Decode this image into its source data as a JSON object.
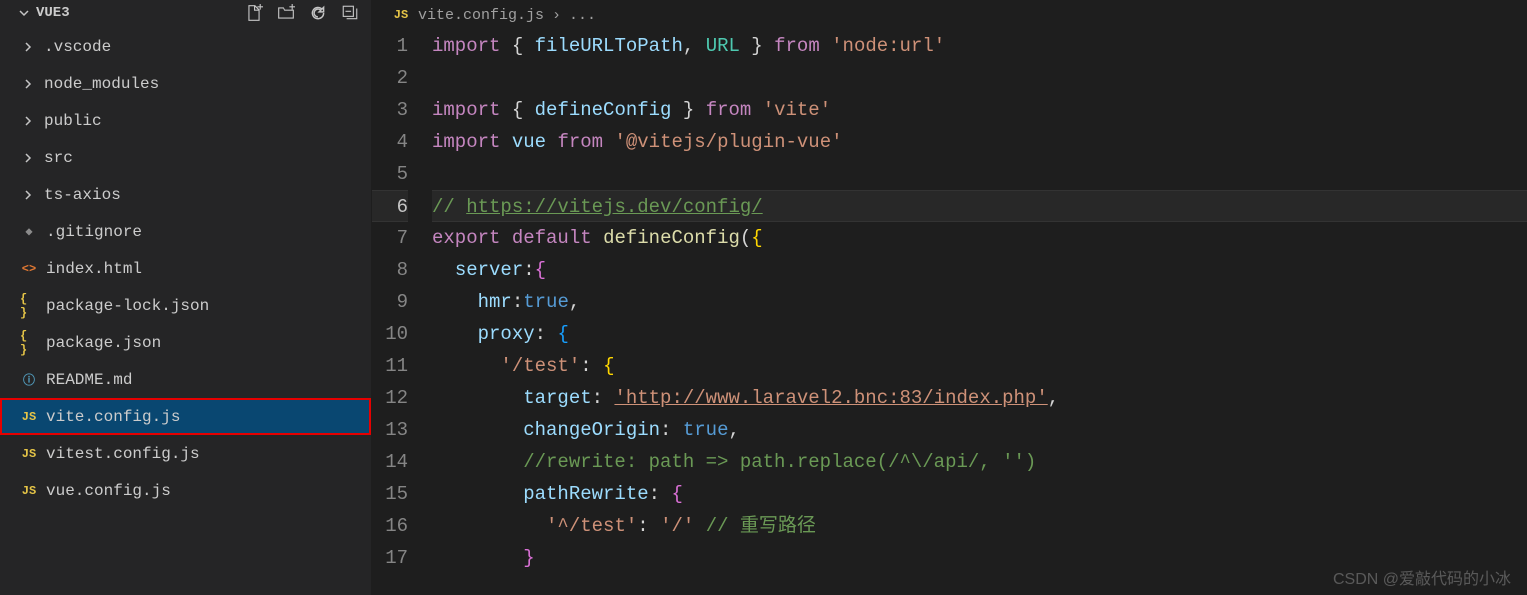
{
  "sidebar": {
    "title": "VUE3",
    "items": [
      {
        "label": ".vscode",
        "type": "folder"
      },
      {
        "label": "node_modules",
        "type": "folder"
      },
      {
        "label": "public",
        "type": "folder"
      },
      {
        "label": "src",
        "type": "folder"
      },
      {
        "label": "ts-axios",
        "type": "folder"
      },
      {
        "label": ".gitignore",
        "type": "git"
      },
      {
        "label": "index.html",
        "type": "html"
      },
      {
        "label": "package-lock.json",
        "type": "json"
      },
      {
        "label": "package.json",
        "type": "json"
      },
      {
        "label": "README.md",
        "type": "info"
      },
      {
        "label": "vite.config.js",
        "type": "js",
        "selected": true,
        "highlighted": true
      },
      {
        "label": "vitest.config.js",
        "type": "js"
      },
      {
        "label": "vue.config.js",
        "type": "js"
      }
    ]
  },
  "breadcrumb": {
    "file": "vite.config.js",
    "sep": "›",
    "more": "..."
  },
  "code": {
    "lines": [
      {
        "n": 1,
        "tokens": [
          [
            "kw",
            "import"
          ],
          [
            "punc",
            " { "
          ],
          [
            "var",
            "fileURLToPath"
          ],
          [
            "punc",
            ", "
          ],
          [
            "type",
            "URL"
          ],
          [
            "punc",
            " } "
          ],
          [
            "kw",
            "from"
          ],
          [
            "punc",
            " "
          ],
          [
            "str",
            "'node:url'"
          ]
        ]
      },
      {
        "n": 2,
        "tokens": []
      },
      {
        "n": 3,
        "tokens": [
          [
            "kw",
            "import"
          ],
          [
            "punc",
            " { "
          ],
          [
            "var",
            "defineConfig"
          ],
          [
            "punc",
            " } "
          ],
          [
            "kw",
            "from"
          ],
          [
            "punc",
            " "
          ],
          [
            "str",
            "'vite'"
          ]
        ]
      },
      {
        "n": 4,
        "tokens": [
          [
            "kw",
            "import"
          ],
          [
            "punc",
            " "
          ],
          [
            "var",
            "vue"
          ],
          [
            "punc",
            " "
          ],
          [
            "kw",
            "from"
          ],
          [
            "punc",
            " "
          ],
          [
            "str",
            "'@vitejs/plugin-vue'"
          ]
        ]
      },
      {
        "n": 5,
        "tokens": []
      },
      {
        "n": 6,
        "current": true,
        "tokens": [
          [
            "comment",
            "// "
          ],
          [
            "comment-u",
            "https://vitejs.dev/config/"
          ]
        ]
      },
      {
        "n": 7,
        "tokens": [
          [
            "kw",
            "export"
          ],
          [
            "punc",
            " "
          ],
          [
            "kw",
            "default"
          ],
          [
            "punc",
            " "
          ],
          [
            "fn",
            "defineConfig"
          ],
          [
            "punc",
            "("
          ],
          [
            "brace",
            "{"
          ]
        ]
      },
      {
        "n": 8,
        "indent": 1,
        "tokens": [
          [
            "var",
            "server"
          ],
          [
            "punc",
            ":"
          ],
          [
            "brace2",
            "{"
          ]
        ]
      },
      {
        "n": 9,
        "indent": 2,
        "tokens": [
          [
            "var",
            "hmr"
          ],
          [
            "punc",
            ":"
          ],
          [
            "const",
            "true"
          ],
          [
            "punc",
            ","
          ]
        ]
      },
      {
        "n": 10,
        "indent": 2,
        "tokens": [
          [
            "var",
            "proxy"
          ],
          [
            "punc",
            ": "
          ],
          [
            "brace3",
            "{"
          ]
        ]
      },
      {
        "n": 11,
        "indent": 3,
        "tokens": [
          [
            "str",
            "'/test'"
          ],
          [
            "punc",
            ": "
          ],
          [
            "brace",
            "{"
          ]
        ]
      },
      {
        "n": 12,
        "indent": 4,
        "tokens": [
          [
            "var",
            "target"
          ],
          [
            "punc",
            ": "
          ],
          [
            "str-u",
            "'http://www.laravel2.bnc:83/index.php'"
          ],
          [
            "punc",
            ","
          ]
        ]
      },
      {
        "n": 13,
        "indent": 4,
        "tokens": [
          [
            "var",
            "changeOrigin"
          ],
          [
            "punc",
            ": "
          ],
          [
            "const",
            "true"
          ],
          [
            "punc",
            ","
          ]
        ]
      },
      {
        "n": 14,
        "indent": 4,
        "tokens": [
          [
            "comment",
            "//rewrite: path => path.replace(/^\\/api/, '')"
          ]
        ]
      },
      {
        "n": 15,
        "indent": 4,
        "tokens": [
          [
            "var",
            "pathRewrite"
          ],
          [
            "punc",
            ": "
          ],
          [
            "brace2",
            "{"
          ]
        ]
      },
      {
        "n": 16,
        "indent": 5,
        "tokens": [
          [
            "str",
            "'^/test'"
          ],
          [
            "punc",
            ": "
          ],
          [
            "str",
            "'/'"
          ],
          [
            "punc",
            " "
          ],
          [
            "comment",
            "// 重写路径"
          ]
        ]
      },
      {
        "n": 17,
        "indent": 4,
        "tokens": [
          [
            "brace2",
            "}"
          ]
        ]
      }
    ]
  },
  "watermark": "CSDN @爱敲代码的小冰"
}
